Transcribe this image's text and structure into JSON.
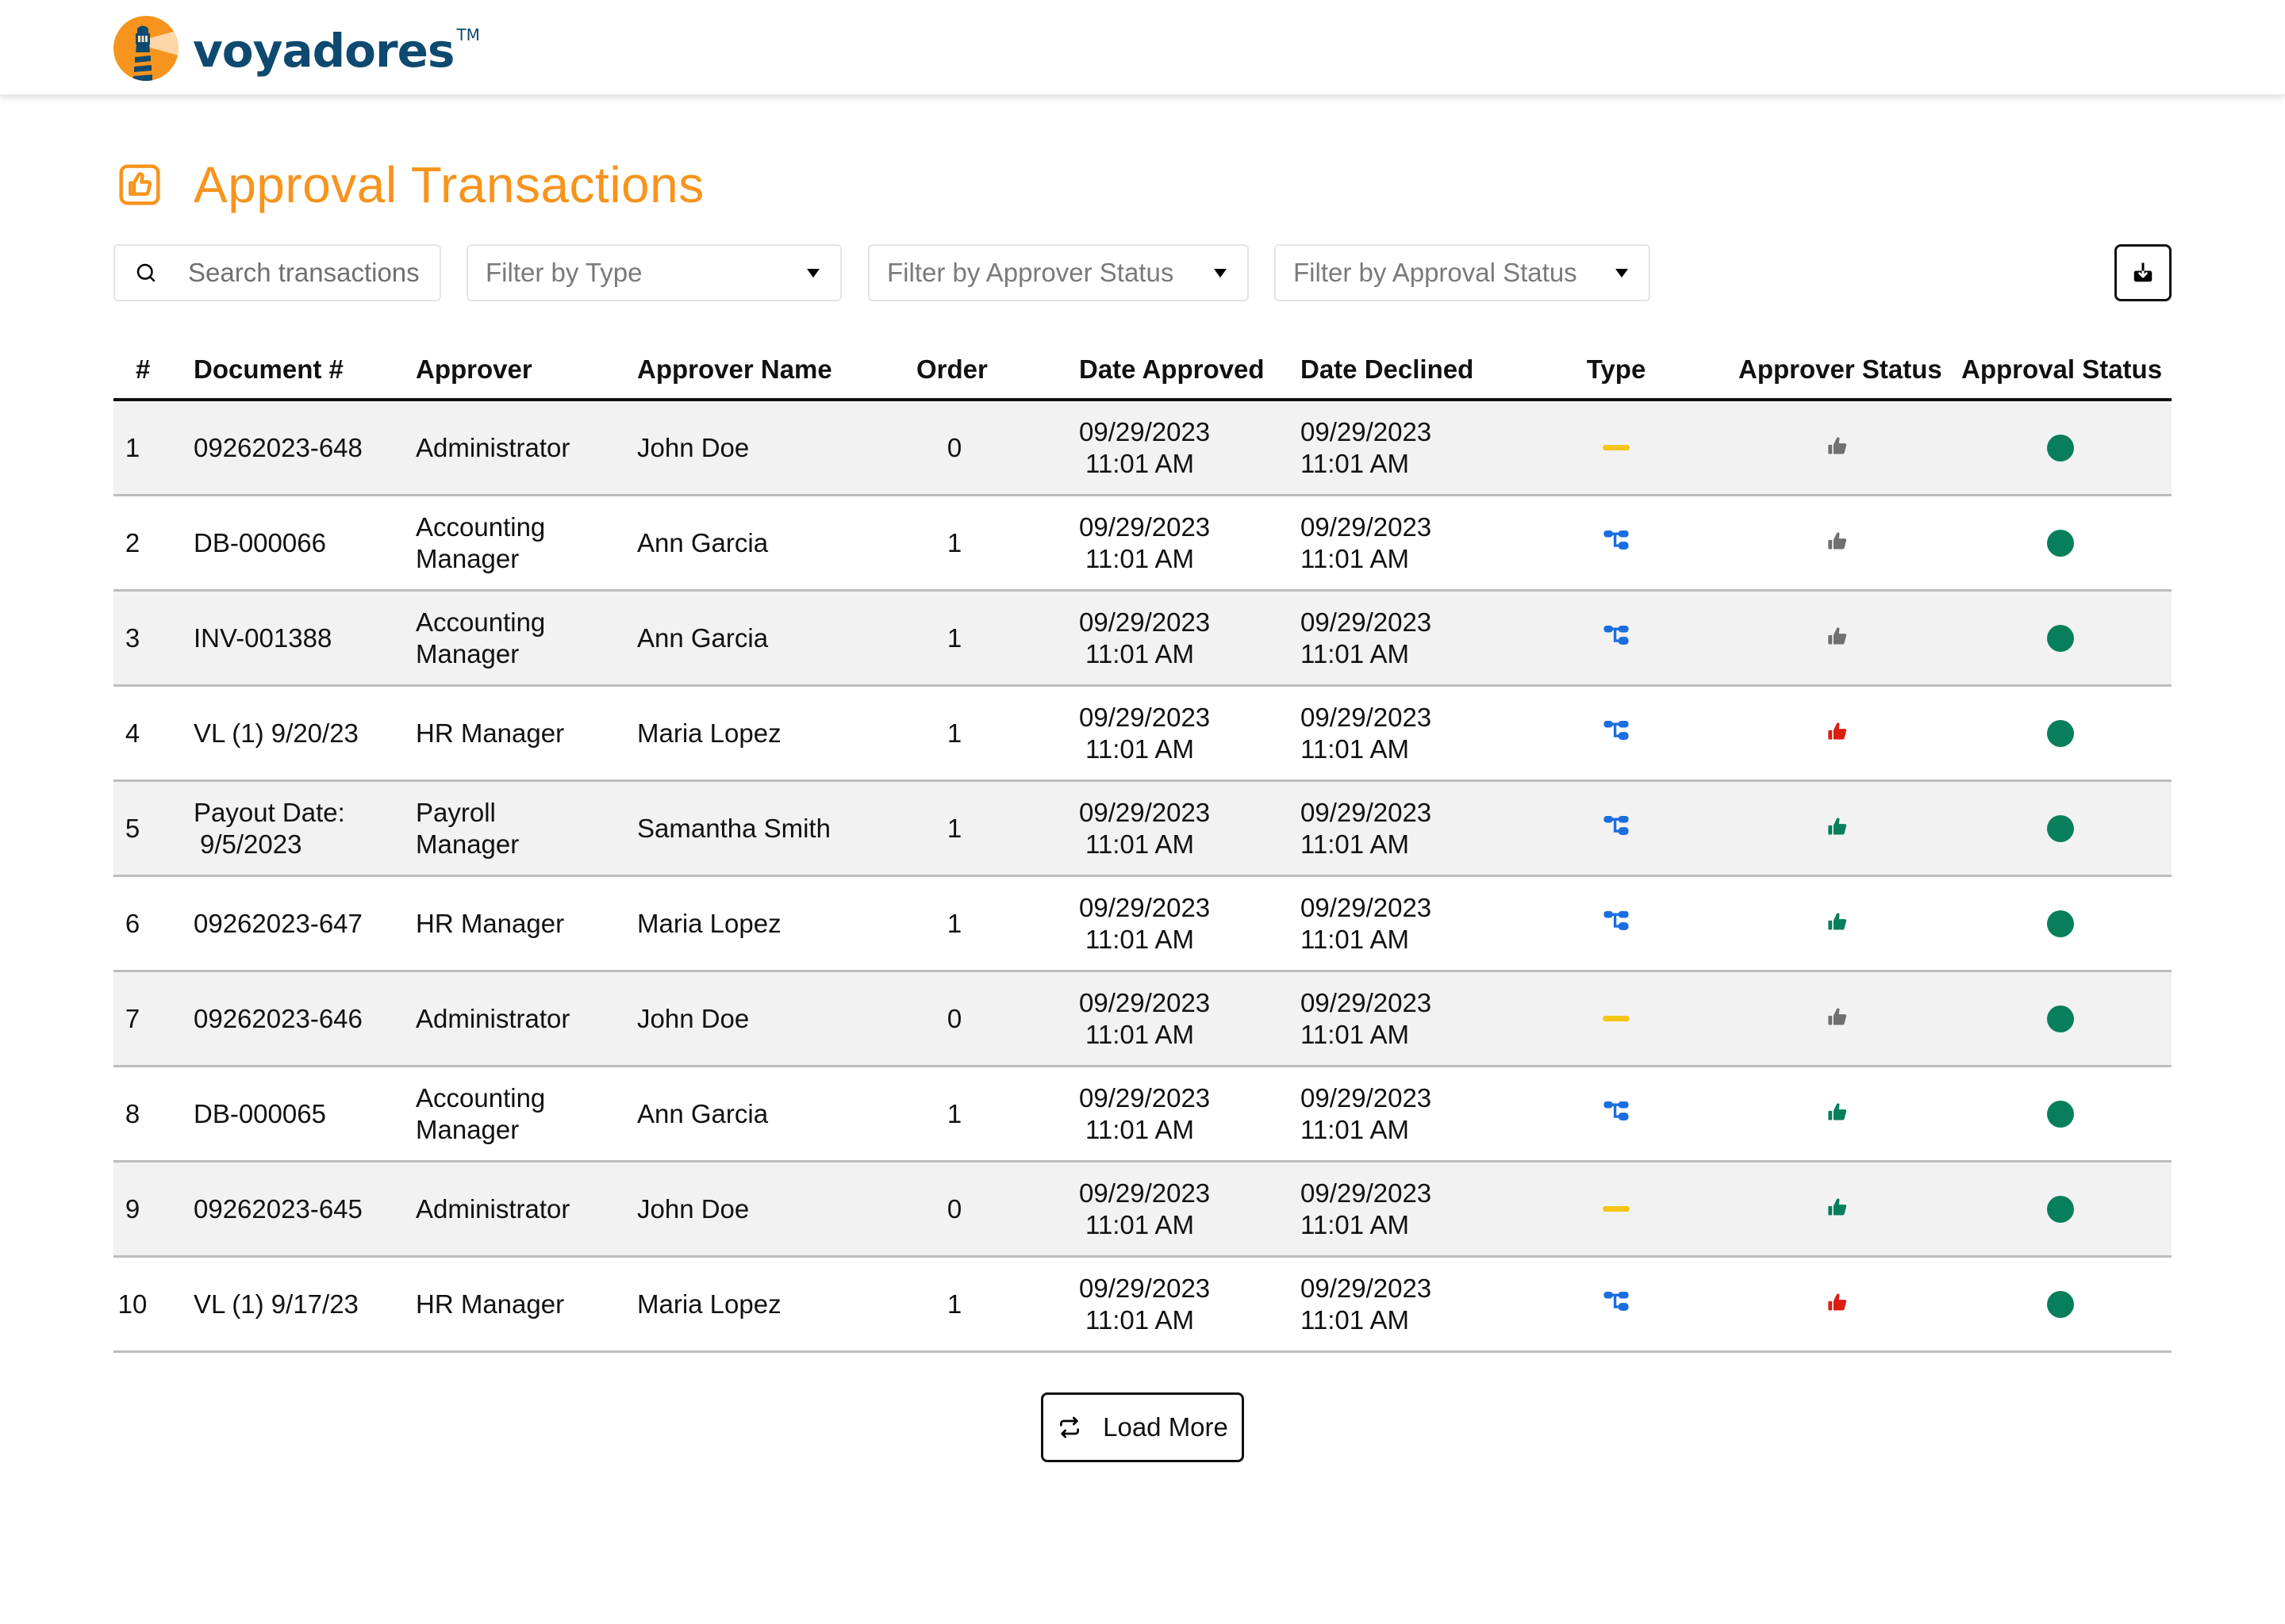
{
  "app": {
    "brand_name": "voyadores",
    "brand_tm": "TM"
  },
  "colors": {
    "brand_orange": "#f7941d",
    "brand_navy": "#0e4a70",
    "type_workflow": "#1a6ee0",
    "type_none": "#f5c518",
    "status_pending": "#707070",
    "status_approved": "#087f5b",
    "status_declined": "#d91e12",
    "approval_dot": "#087f5b",
    "row_alt": "#f2f2f2"
  },
  "header": {
    "icons": [
      "home-icon",
      "users-icon",
      "user-circle-icon"
    ]
  },
  "page": {
    "title": "Approval Transactions",
    "title_icon": "thumbs-up-square-icon"
  },
  "filters": {
    "search_placeholder": "Search transactions",
    "search_value": "",
    "type_placeholder": "Filter by Type",
    "approver_status_placeholder": "Filter by Approver Status",
    "approval_status_placeholder": "Filter by Approval Status",
    "download_icon": "download-icon"
  },
  "table": {
    "columns": [
      "#",
      "Document #",
      "Approver",
      "Approver Name",
      "Order",
      "Date Approved",
      "Date Declined",
      "Type",
      "Approver Status",
      "Approval Status"
    ],
    "rows": [
      {
        "num": "1",
        "document": [
          "09262023-648"
        ],
        "approver": [
          "Administrator"
        ],
        "name": "John Doe",
        "order": "0",
        "date_approved": [
          "09/29/2023",
          "11:01 AM"
        ],
        "date_declined": [
          "09/29/2023",
          "11:01 AM"
        ],
        "type": "none",
        "approver_status": "pending",
        "approval_status": "approved"
      },
      {
        "num": "2",
        "document": [
          "DB-000066"
        ],
        "approver": [
          "Accounting",
          "Manager"
        ],
        "name": "Ann Garcia",
        "order": "1",
        "date_approved": [
          "09/29/2023",
          "11:01 AM"
        ],
        "date_declined": [
          "09/29/2023",
          "11:01 AM"
        ],
        "type": "workflow",
        "approver_status": "pending",
        "approval_status": "approved"
      },
      {
        "num": "3",
        "document": [
          "INV-001388"
        ],
        "approver": [
          "Accounting",
          "Manager"
        ],
        "name": "Ann Garcia",
        "order": "1",
        "date_approved": [
          "09/29/2023",
          "11:01 AM"
        ],
        "date_declined": [
          "09/29/2023",
          "11:01 AM"
        ],
        "type": "workflow",
        "approver_status": "pending",
        "approval_status": "approved"
      },
      {
        "num": "4",
        "document": [
          "VL (1) 9/20/23"
        ],
        "approver": [
          "HR Manager"
        ],
        "name": "Maria Lopez",
        "order": "1",
        "date_approved": [
          "09/29/2023",
          "11:01 AM"
        ],
        "date_declined": [
          "09/29/2023",
          "11:01 AM"
        ],
        "type": "workflow",
        "approver_status": "declined",
        "approval_status": "approved"
      },
      {
        "num": "5",
        "document": [
          "Payout Date:",
          "9/5/2023"
        ],
        "approver": [
          "Payroll",
          "Manager"
        ],
        "name": "Samantha Smith",
        "order": "1",
        "date_approved": [
          "09/29/2023",
          "11:01 AM"
        ],
        "date_declined": [
          "09/29/2023",
          "11:01 AM"
        ],
        "type": "workflow",
        "approver_status": "approved",
        "approval_status": "approved"
      },
      {
        "num": "6",
        "document": [
          "09262023-647"
        ],
        "approver": [
          "HR Manager"
        ],
        "name": "Maria Lopez",
        "order": "1",
        "date_approved": [
          "09/29/2023",
          "11:01 AM"
        ],
        "date_declined": [
          "09/29/2023",
          "11:01 AM"
        ],
        "type": "workflow",
        "approver_status": "approved",
        "approval_status": "approved"
      },
      {
        "num": "7",
        "document": [
          "09262023-646"
        ],
        "approver": [
          "Administrator"
        ],
        "name": "John Doe",
        "order": "0",
        "date_approved": [
          "09/29/2023",
          "11:01 AM"
        ],
        "date_declined": [
          "09/29/2023",
          "11:01 AM"
        ],
        "type": "none",
        "approver_status": "pending",
        "approval_status": "approved"
      },
      {
        "num": "8",
        "document": [
          "DB-000065"
        ],
        "approver": [
          "Accounting",
          "Manager"
        ],
        "name": "Ann Garcia",
        "order": "1",
        "date_approved": [
          "09/29/2023",
          "11:01 AM"
        ],
        "date_declined": [
          "09/29/2023",
          "11:01 AM"
        ],
        "type": "workflow",
        "approver_status": "approved",
        "approval_status": "approved"
      },
      {
        "num": "9",
        "document": [
          "09262023-645"
        ],
        "approver": [
          "Administrator"
        ],
        "name": "John Doe",
        "order": "0",
        "date_approved": [
          "09/29/2023",
          "11:01 AM"
        ],
        "date_declined": [
          "09/29/2023",
          "11:01 AM"
        ],
        "type": "none",
        "approver_status": "approved",
        "approval_status": "approved"
      },
      {
        "num": "10",
        "document": [
          "VL (1) 9/17/23"
        ],
        "approver": [
          "HR Manager"
        ],
        "name": "Maria Lopez",
        "order": "1",
        "date_approved": [
          "09/29/2023",
          "11:01 AM"
        ],
        "date_declined": [
          "09/29/2023",
          "11:01 AM"
        ],
        "type": "workflow",
        "approver_status": "declined",
        "approval_status": "approved"
      }
    ]
  },
  "load_more": {
    "label": "Load More",
    "icon": "repeat-icon"
  }
}
